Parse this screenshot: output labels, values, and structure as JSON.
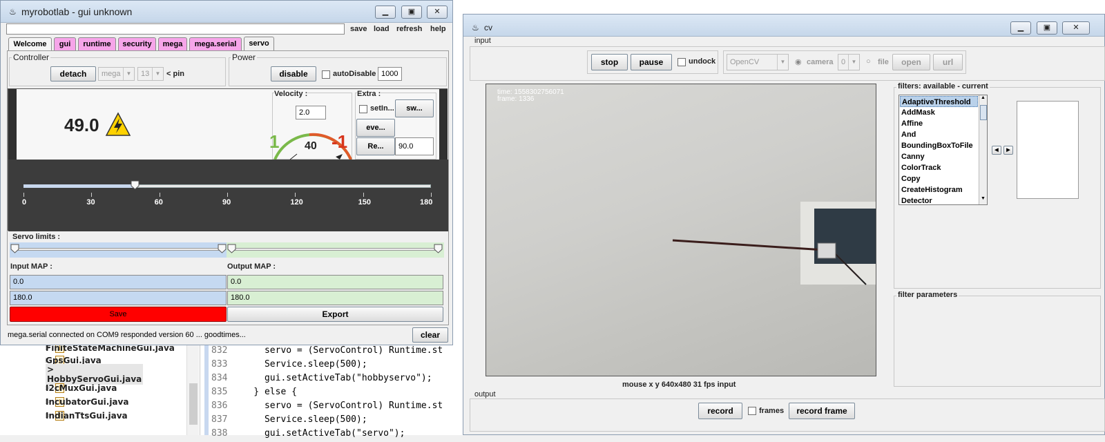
{
  "ide": {
    "tree_items": [
      {
        "label": "FiniteStateMachineGui.java",
        "selected": false
      },
      {
        "label": "GpsGui.java",
        "selected": false
      },
      {
        "label": "> HobbyServoGui.java",
        "selected": true
      },
      {
        "label": "I2cMuxGui.java",
        "selected": false
      },
      {
        "label": "IncubatorGui.java",
        "selected": false
      },
      {
        "label": "IndianTtsGui.java",
        "selected": false
      }
    ],
    "code_lines": [
      {
        "num": "832",
        "text": "      servo = (ServoControl) Runtime.st"
      },
      {
        "num": "833",
        "text": "      Service.sleep(500);"
      },
      {
        "num": "834",
        "text": "      gui.setActiveTab(\"hobbyservo\");"
      },
      {
        "num": "835",
        "text": "    } else {"
      },
      {
        "num": "836",
        "text": "      servo = (ServoControl) Runtime.st"
      },
      {
        "num": "837",
        "text": "      Service.sleep(500);"
      },
      {
        "num": "838",
        "text": "      gui.setActiveTab(\"servo\");"
      }
    ]
  },
  "mrl": {
    "title": "myrobotlab - gui unknown",
    "menu": {
      "save": "save",
      "load": "load",
      "refresh": "refresh",
      "help": "help"
    },
    "tabs": [
      "Welcome",
      "gui",
      "runtime",
      "security",
      "mega",
      "mega.serial",
      "servo"
    ],
    "controller": {
      "group_label": "Controller",
      "detach": "detach",
      "controller_value": "mega",
      "pin_value": "13",
      "pin_label": "< pin"
    },
    "power": {
      "group_label": "Power",
      "disable": "disable",
      "auto_disable_label": "autoDisable",
      "auto_disable_value": "1000"
    },
    "position_value": "49.0",
    "velocity": {
      "label": "Velocity :",
      "value": "2.0",
      "gauge_left": "1",
      "gauge_mid": "40",
      "gauge_right": "-1"
    },
    "extra": {
      "label": "Extra :",
      "setin": "setIn...",
      "sw": "sw...",
      "eve": "eve...",
      "re": "Re...",
      "re_value": "90.0"
    },
    "slider": {
      "min": 0,
      "max": 180,
      "value": 49,
      "ticks": [
        "0",
        "30",
        "60",
        "90",
        "120",
        "150",
        "180"
      ]
    },
    "servo_limits_label": "Servo limits :",
    "input_map": {
      "label": "Input MAP :",
      "min": "0.0",
      "max": "180.0"
    },
    "output_map": {
      "label": "Output MAP :",
      "min": "0.0",
      "max": "180.0"
    },
    "save": "Save",
    "export": "Export",
    "status": "mega.serial connected on COM9 responded version 60 ... goodtimes...",
    "clear": "clear"
  },
  "cv": {
    "title": "cv",
    "input_label": "input",
    "stop": "stop",
    "pause": "pause",
    "undock": "undock",
    "grabber": "OpenCV",
    "camera_label": "camera",
    "camera_index": "0",
    "file_label": "file",
    "open": "open",
    "url": "url",
    "overlay_time": "time:  1558302756071",
    "overlay_frame": "frame: 1336",
    "video_status": "mouse x y  640x480  31 fps  input",
    "filters_label": "filters: available - current",
    "filters": [
      "AdaptiveThreshold",
      "AddMask",
      "Affine",
      "And",
      "BoundingBoxToFile",
      "Canny",
      "ColorTrack",
      "Copy",
      "CreateHistogram",
      "Detector"
    ],
    "selected_filter": "AdaptiveThreshold",
    "filter_params_label": "filter parameters",
    "output_label": "output",
    "record": "record",
    "frames": "frames",
    "record_frame": "record frame"
  },
  "colors": {
    "pink_tab": "#f6a5e9",
    "input_map": "#c5d9f1",
    "output_map": "#d8efd3",
    "save_red": "#ff0000",
    "warning_yellow": "#ffd200"
  }
}
